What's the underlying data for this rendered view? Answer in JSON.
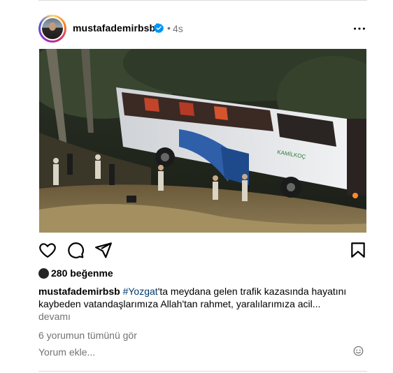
{
  "post": {
    "username": "mustafademirbsb",
    "separator": "•",
    "age": "4s",
    "photo_alt": "photo-bus-accident-scene",
    "likes_count": "280",
    "likes_suffix": "beğenme",
    "likes_label": "280 beğenme",
    "caption_user": "mustafademirbsb",
    "caption_hashtag": "#Yozgat",
    "caption_text": "'ta meydana gelen trafik kazasında hayatını kaybeden vatandaşlarımıza Allah'tan rahmet, yaralılarımıza acil...",
    "more_label": "devamı",
    "view_comments": "6 yorumun tümünü gör",
    "comment_placeholder": "Yorum ekle..."
  },
  "colors": {
    "verified": "#0095f6",
    "muted_text": "#737373",
    "hashtag": "#00376b",
    "divider": "#dbdbdb"
  },
  "icons": [
    "verified-badge-icon",
    "more-options-icon",
    "heart-icon",
    "comment-icon",
    "share-icon",
    "bookmark-icon",
    "likes-avatar-icon",
    "emoji-icon"
  ]
}
